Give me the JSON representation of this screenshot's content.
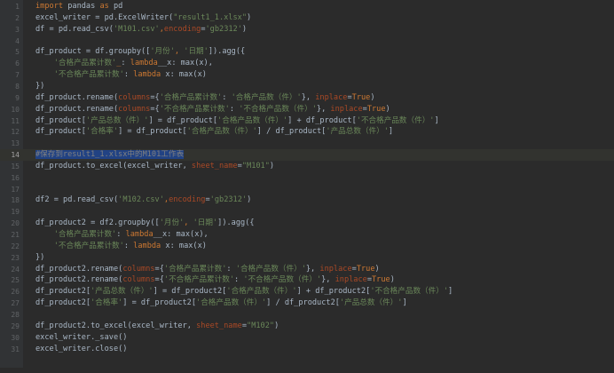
{
  "editor": {
    "lines": [
      {
        "n": "1",
        "t": [
          [
            "kw",
            "import"
          ],
          [
            "t",
            " pandas "
          ],
          [
            "kw",
            "as"
          ],
          [
            "t",
            " pd"
          ]
        ]
      },
      {
        "n": "2",
        "t": [
          [
            "t",
            "excel_writer = pd.ExcelWriter("
          ],
          [
            "str",
            "\"result1_1.xlsx\""
          ],
          [
            "t",
            ")"
          ]
        ]
      },
      {
        "n": "3",
        "t": [
          [
            "t",
            "df = pd.read_csv("
          ],
          [
            "str",
            "'M101.csv'"
          ],
          [
            "kw",
            ","
          ],
          [
            "param",
            "encoding"
          ],
          [
            "t",
            "="
          ],
          [
            "str",
            "'gb2312'"
          ],
          [
            "t",
            ")"
          ]
        ]
      },
      {
        "n": "4",
        "t": []
      },
      {
        "n": "5",
        "t": [
          [
            "t",
            "df_product = df.groupby(["
          ],
          [
            "str",
            "'月份'"
          ],
          [
            "kw",
            ", "
          ],
          [
            "str",
            "'日期'"
          ],
          [
            "t",
            "]).agg({"
          ]
        ]
      },
      {
        "n": "6",
        "t": [
          [
            "t",
            "    "
          ],
          [
            "str",
            "'合格产品累计数'"
          ],
          [
            "kw",
            "_"
          ],
          [
            "t",
            ": "
          ],
          [
            "kw",
            "lambda"
          ],
          [
            "t",
            "__x: max(x),"
          ]
        ]
      },
      {
        "n": "7",
        "t": [
          [
            "t",
            "    "
          ],
          [
            "str",
            "'不合格产品累计数'"
          ],
          [
            "t",
            ": "
          ],
          [
            "kw",
            "lambda"
          ],
          [
            "t",
            " x: max(x)"
          ]
        ]
      },
      {
        "n": "8",
        "t": [
          [
            "t",
            "})"
          ]
        ]
      },
      {
        "n": "9",
        "t": [
          [
            "t",
            "df_product.rename("
          ],
          [
            "param",
            "columns"
          ],
          [
            "t",
            "={"
          ],
          [
            "str",
            "'合格产品累计数'"
          ],
          [
            "t",
            ": "
          ],
          [
            "str",
            "'合格产品数（件）'"
          ],
          [
            "t",
            "}, "
          ],
          [
            "param",
            "inplace"
          ],
          [
            "t",
            "="
          ],
          [
            "kw",
            "True"
          ],
          [
            "t",
            ")"
          ]
        ]
      },
      {
        "n": "10",
        "t": [
          [
            "t",
            "df_product.rename("
          ],
          [
            "param",
            "columns"
          ],
          [
            "t",
            "={"
          ],
          [
            "str",
            "'不合格产品累计数'"
          ],
          [
            "t",
            ": "
          ],
          [
            "str",
            "'不合格产品数（件）'"
          ],
          [
            "t",
            "}, "
          ],
          [
            "param",
            "inplace"
          ],
          [
            "t",
            "="
          ],
          [
            "kw",
            "True"
          ],
          [
            "t",
            ")"
          ]
        ]
      },
      {
        "n": "11",
        "t": [
          [
            "t",
            "df_product["
          ],
          [
            "str",
            "'产品总数（件）'"
          ],
          [
            "t",
            "] = df_product["
          ],
          [
            "str",
            "'合格产品数（件）'"
          ],
          [
            "t",
            "] + df_product["
          ],
          [
            "str",
            "'不合格产品数（件）'"
          ],
          [
            "t",
            "]"
          ]
        ]
      },
      {
        "n": "12",
        "t": [
          [
            "t",
            "df_product["
          ],
          [
            "str",
            "'合格率'"
          ],
          [
            "t",
            "] = df_product["
          ],
          [
            "str",
            "'合格产品数（件）'"
          ],
          [
            "t",
            "] / df_product["
          ],
          [
            "str",
            "'产品总数（件）'"
          ],
          [
            "t",
            "]"
          ]
        ]
      },
      {
        "n": "13",
        "t": []
      },
      {
        "n": "14",
        "t": [
          [
            "sel",
            "#保存到result1_1.xlsx中的M101工作表"
          ]
        ],
        "current": true
      },
      {
        "n": "15",
        "t": [
          [
            "t",
            "df_product.to_excel(excel_writer, "
          ],
          [
            "param",
            "sheet_name"
          ],
          [
            "t",
            "="
          ],
          [
            "str",
            "\"M101\""
          ],
          [
            "t",
            ")"
          ]
        ]
      },
      {
        "n": "16",
        "t": []
      },
      {
        "n": "17",
        "t": []
      },
      {
        "n": "18",
        "t": [
          [
            "t",
            "df2 = pd.read_csv("
          ],
          [
            "str",
            "'M102.csv'"
          ],
          [
            "kw",
            ","
          ],
          [
            "param",
            "encoding"
          ],
          [
            "t",
            "="
          ],
          [
            "str",
            "'gb2312'"
          ],
          [
            "t",
            ")"
          ]
        ]
      },
      {
        "n": "19",
        "t": []
      },
      {
        "n": "20",
        "t": [
          [
            "t",
            "df_product2 = df2.groupby(["
          ],
          [
            "str",
            "'月份'"
          ],
          [
            "kw",
            ", "
          ],
          [
            "str",
            "'日期'"
          ],
          [
            "t",
            "]).agg({"
          ]
        ]
      },
      {
        "n": "21",
        "t": [
          [
            "t",
            "    "
          ],
          [
            "str",
            "'合格产品累计数'"
          ],
          [
            "t",
            ": "
          ],
          [
            "kw",
            "lambda"
          ],
          [
            "t",
            "__x: max(x),"
          ]
        ]
      },
      {
        "n": "22",
        "t": [
          [
            "t",
            "    "
          ],
          [
            "str",
            "'不合格产品累计数'"
          ],
          [
            "t",
            ": "
          ],
          [
            "kw",
            "lambda"
          ],
          [
            "t",
            " x: max(x)"
          ]
        ]
      },
      {
        "n": "23",
        "t": [
          [
            "t",
            "})"
          ]
        ]
      },
      {
        "n": "24",
        "t": [
          [
            "t",
            "df_product2.rename("
          ],
          [
            "param",
            "columns"
          ],
          [
            "t",
            "={"
          ],
          [
            "str",
            "'合格产品累计数'"
          ],
          [
            "t",
            ": "
          ],
          [
            "str",
            "'合格产品数（件）'"
          ],
          [
            "t",
            "}, "
          ],
          [
            "param",
            "inplace"
          ],
          [
            "t",
            "="
          ],
          [
            "kw",
            "True"
          ],
          [
            "t",
            ")"
          ]
        ]
      },
      {
        "n": "25",
        "t": [
          [
            "t",
            "df_product2.rename("
          ],
          [
            "param",
            "columns"
          ],
          [
            "t",
            "={"
          ],
          [
            "str",
            "'不合格产品累计数'"
          ],
          [
            "t",
            ": "
          ],
          [
            "str",
            "'不合格产品数（件）'"
          ],
          [
            "t",
            "}, "
          ],
          [
            "param",
            "inplace"
          ],
          [
            "t",
            "="
          ],
          [
            "kw",
            "True"
          ],
          [
            "t",
            ")"
          ]
        ]
      },
      {
        "n": "26",
        "t": [
          [
            "t",
            "df_product2["
          ],
          [
            "str",
            "'产品总数（件）'"
          ],
          [
            "t",
            "] = df_product2["
          ],
          [
            "str",
            "'合格产品数（件）'"
          ],
          [
            "t",
            "] + df_product2["
          ],
          [
            "str",
            "'不合格产品数（件）'"
          ],
          [
            "t",
            "]"
          ]
        ]
      },
      {
        "n": "27",
        "t": [
          [
            "t",
            "df_product2["
          ],
          [
            "str",
            "'合格率'"
          ],
          [
            "t",
            "] = df_product2["
          ],
          [
            "str",
            "'合格产品数（件）'"
          ],
          [
            "t",
            "] / df_product2["
          ],
          [
            "str",
            "'产品总数（件）'"
          ],
          [
            "t",
            "]"
          ]
        ]
      },
      {
        "n": "28",
        "t": []
      },
      {
        "n": "29",
        "t": [
          [
            "t",
            "df_product2.to_excel(excel_writer, "
          ],
          [
            "param",
            "sheet_name"
          ],
          [
            "t",
            "="
          ],
          [
            "str",
            "\"M102\""
          ],
          [
            "t",
            ")"
          ]
        ]
      },
      {
        "n": "30",
        "t": [
          [
            "t",
            "excel_writer._save()"
          ]
        ]
      },
      {
        "n": "31",
        "t": [
          [
            "t",
            "excel_writer.close()"
          ]
        ]
      }
    ],
    "colors": {
      "background": "#2b2b2b",
      "gutter": "#313335",
      "keyword": "#cc7832",
      "string": "#6a8759",
      "parameter": "#aa4926",
      "default": "#a9b7c6",
      "selection": "#214283"
    }
  }
}
